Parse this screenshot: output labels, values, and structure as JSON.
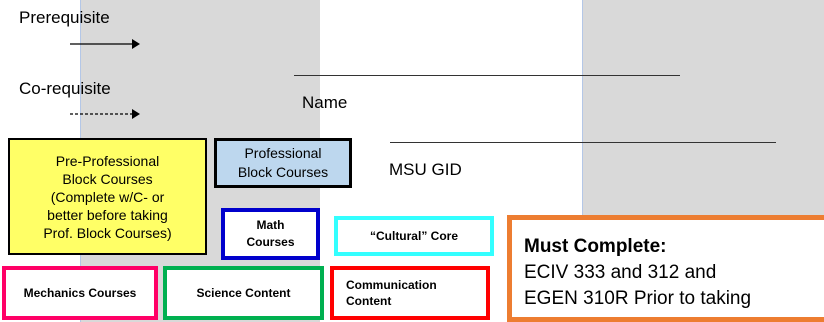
{
  "legend": {
    "prerequisite": "Prerequisite",
    "corequisite": "Co-requisite"
  },
  "form": {
    "name_label": "Name",
    "gid_label": "MSU GID"
  },
  "boxes": {
    "pre_professional": [
      "Pre-Professional",
      "Block Courses",
      "(Complete w/C- or",
      "better before taking",
      "Prof. Block Courses)"
    ],
    "professional": [
      "Professional",
      "Block Courses"
    ],
    "math": [
      "Math",
      "Courses"
    ],
    "cultural": "“Cultural” Core",
    "mechanics": "Mechanics Courses",
    "science": "Science Content",
    "communication": [
      "Communication",
      "Content"
    ],
    "must_complete": {
      "title": "Must Complete:",
      "lines": [
        "ECIV 333 and 312 and",
        "EGEN 310R  Prior to taking"
      ]
    }
  },
  "colors": {
    "pre_professional_fill": "#ffff66",
    "professional_fill": "#bdd7ee",
    "math_border": "#0000cc",
    "cultural_border": "#33ffff",
    "mechanics_border": "#ff0066",
    "science_border": "#00b050",
    "communication_border": "#ff0000",
    "must_border": "#ed7d31"
  }
}
